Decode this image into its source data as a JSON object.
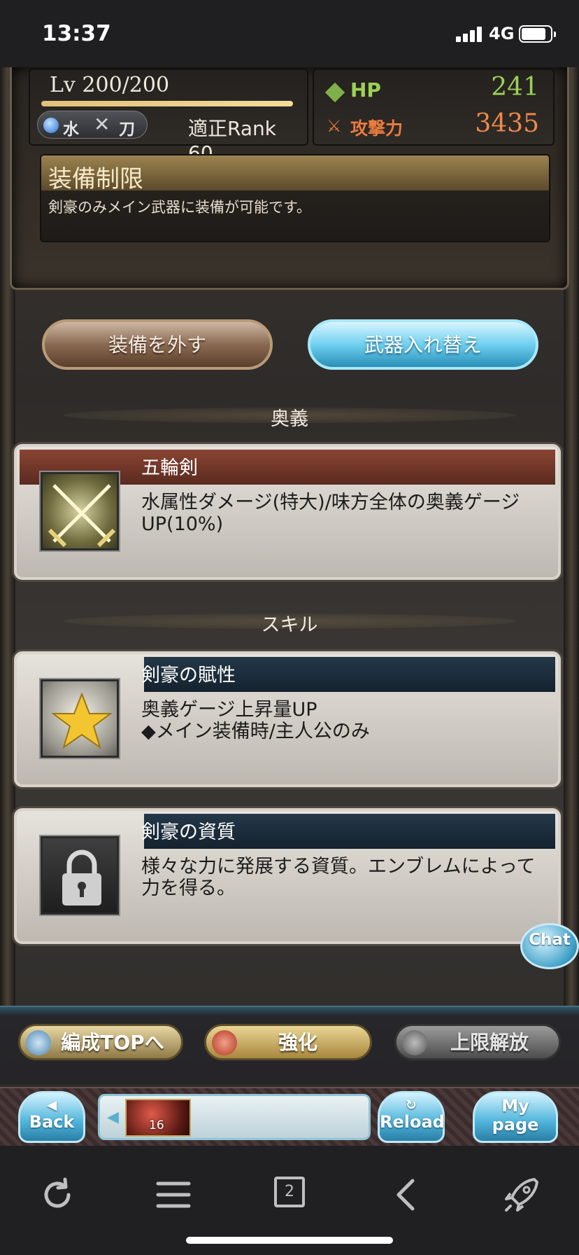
{
  "status_bar": {
    "time": "13:37",
    "network": "4G"
  },
  "weapon": {
    "level": "Lv 200/200",
    "element": "水",
    "weapon_type": "刀",
    "rank": "適正Rank 60",
    "hp_label": "HP",
    "hp_value": "241",
    "atk_label": "攻撃力",
    "atk_value": "3435"
  },
  "restriction": {
    "title": "装備制限",
    "description": "剣豪のみメイン武器に装備が可能です。"
  },
  "actions": {
    "remove_label": "装備を外す",
    "swap_label": "武器入れ替え"
  },
  "ougi": {
    "section_title": "奥義",
    "name": "五輪剣",
    "description": "水属性ダメージ(特大)/味方全体の奥義ゲージUP(10%)"
  },
  "skills": {
    "section_title": "スキル",
    "items": [
      {
        "name": "剣豪の賦性",
        "description": "奥義ゲージ上昇量UP\n◆メイン装備時/主人公のみ",
        "icon": "star-icon"
      },
      {
        "name": "剣豪の資質",
        "description": "様々な力に発展する資質。エンブレムによって力を得る。",
        "icon": "lock-icon"
      }
    ]
  },
  "chat": {
    "label": "Chat"
  },
  "bottom_panel": {
    "team_label": "編成TOPへ",
    "upgrade_label": "強化",
    "uncap_label": "上限解放"
  },
  "nav": {
    "back_line1": "◀",
    "back_line2": "Back",
    "reload_line1": "↻",
    "reload_line2": "Reload",
    "mypage_line1": "My",
    "mypage_line2": "page",
    "quest_count": "16"
  },
  "browser": {
    "tab_count": "2"
  },
  "colors": {
    "hp": "#9bd157",
    "atk": "#ef8a49",
    "swap_button": "#6fd0ef"
  }
}
